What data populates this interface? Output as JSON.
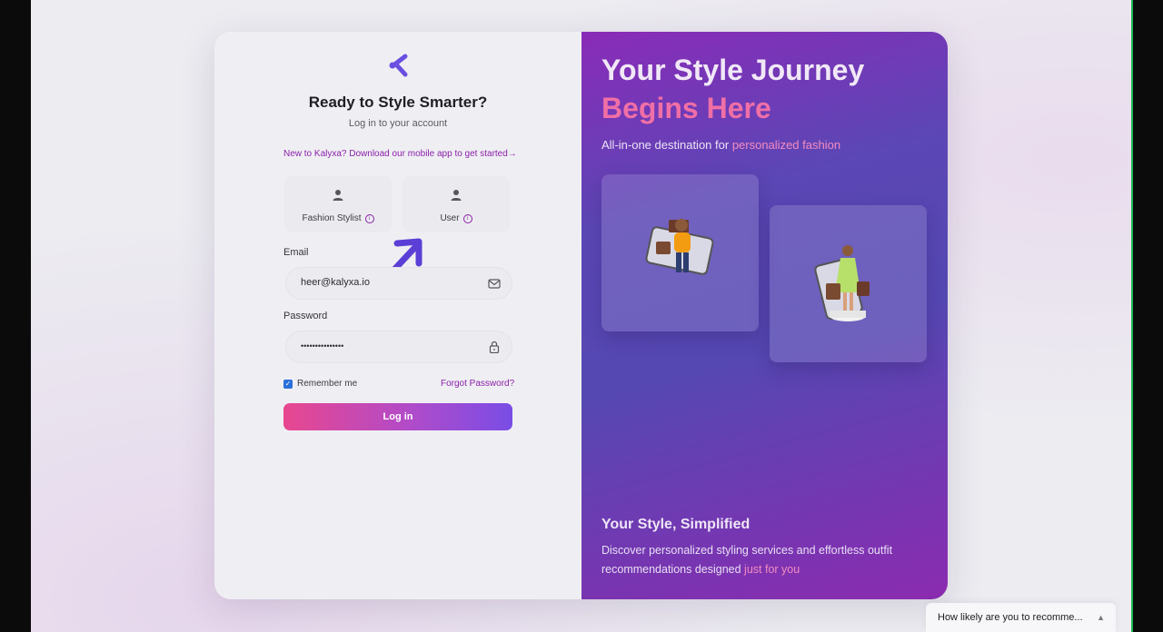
{
  "login": {
    "title": "Ready to Style Smarter?",
    "subtitle": "Log in to your account",
    "new_user_link": "New to Kalyxa? Download our mobile app to get started→",
    "roles": [
      {
        "label": "Fashion Stylist",
        "icon": "person-icon",
        "info_icon": "info-icon"
      },
      {
        "label": "User",
        "icon": "person-icon",
        "info_icon": "info-icon"
      }
    ],
    "email": {
      "label": "Email",
      "value": "heer@kalyxa.io",
      "icon": "mail-icon"
    },
    "password": {
      "label": "Password",
      "value": "•••••••••••••••",
      "icon": "lock-icon"
    },
    "remember_label": "Remember me",
    "remember_checked": true,
    "forgot_label": "Forgot Password?",
    "login_button": "Log in",
    "colors": {
      "accent": "#8b1fa8",
      "button_start": "#e8478f",
      "button_end": "#7a4de6"
    }
  },
  "promo": {
    "hero_line1": "Your Style Journey",
    "hero_line2": "Begins Here",
    "tagline_prefix": "All-in-one destination for ",
    "tagline_highlight": "personalized fashion",
    "bottom_title": "Your Style, Simplified",
    "bottom_text": "Discover personalized styling services and effortless outfit recommendations designed ",
    "bottom_highlight": "just for you",
    "colors": {
      "gradient_top": "#8a2bb8",
      "gradient_mid": "#5548b3",
      "highlight": "#f48cc0"
    }
  },
  "survey": {
    "label": "How likely are you to recomme...",
    "icon": "caret-up-icon"
  }
}
